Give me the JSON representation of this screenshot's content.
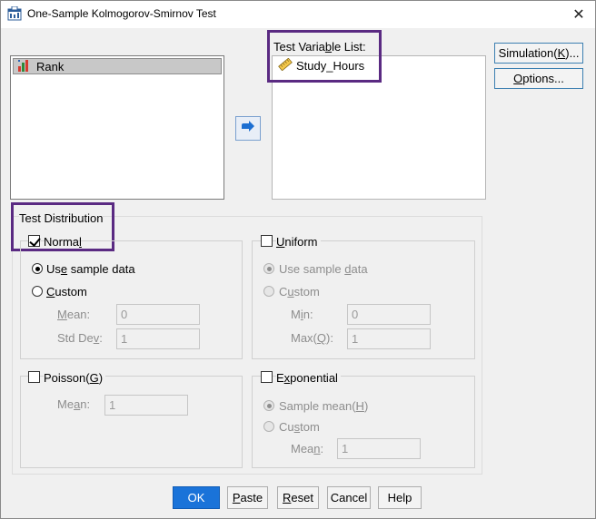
{
  "window": {
    "title": "One-Sample Kolmogorov-Smirnov Test",
    "close_glyph": "✕"
  },
  "source_list": {
    "items": [
      {
        "label": "Rank",
        "icon": "ordinal-bar-chart-icon"
      }
    ]
  },
  "test_variable_list": {
    "label": "Test Variable List:",
    "items": [
      {
        "label": "Study_Hours",
        "icon": "ruler-scale-icon"
      }
    ]
  },
  "side_buttons": {
    "simulation": "Simulation(K)...",
    "options": "Options..."
  },
  "test_distribution": {
    "label": "Test Distribution",
    "normal": {
      "label": "Normal",
      "checked": true,
      "use_sample": "Use sample data",
      "custom": "Custom",
      "mean_label": "Mean:",
      "mean_value": "0",
      "std_label": "Std Dev:",
      "std_value": "1"
    },
    "uniform": {
      "label": "Uniform",
      "checked": false,
      "use_sample": "Use sample data",
      "custom": "Custom",
      "min_label": "Min:",
      "min_value": "0",
      "max_label": "Max(Q):",
      "max_value": "1"
    },
    "poisson": {
      "label": "Poisson(G)",
      "checked": false,
      "mean_label": "Mean:",
      "mean_value": "1"
    },
    "exponential": {
      "label": "Exponential",
      "checked": false,
      "sample_mean": "Sample mean(H)",
      "custom": "Custom",
      "mean_label": "Mean:",
      "mean_value": "1"
    }
  },
  "footer": {
    "ok": "OK",
    "paste": "Paste",
    "reset": "Reset",
    "cancel": "Cancel",
    "help": "Help"
  },
  "colors": {
    "highlight": "#5a2a82",
    "ok_button": "#1a73d9",
    "dialog_bg": "#f0f0f0"
  }
}
